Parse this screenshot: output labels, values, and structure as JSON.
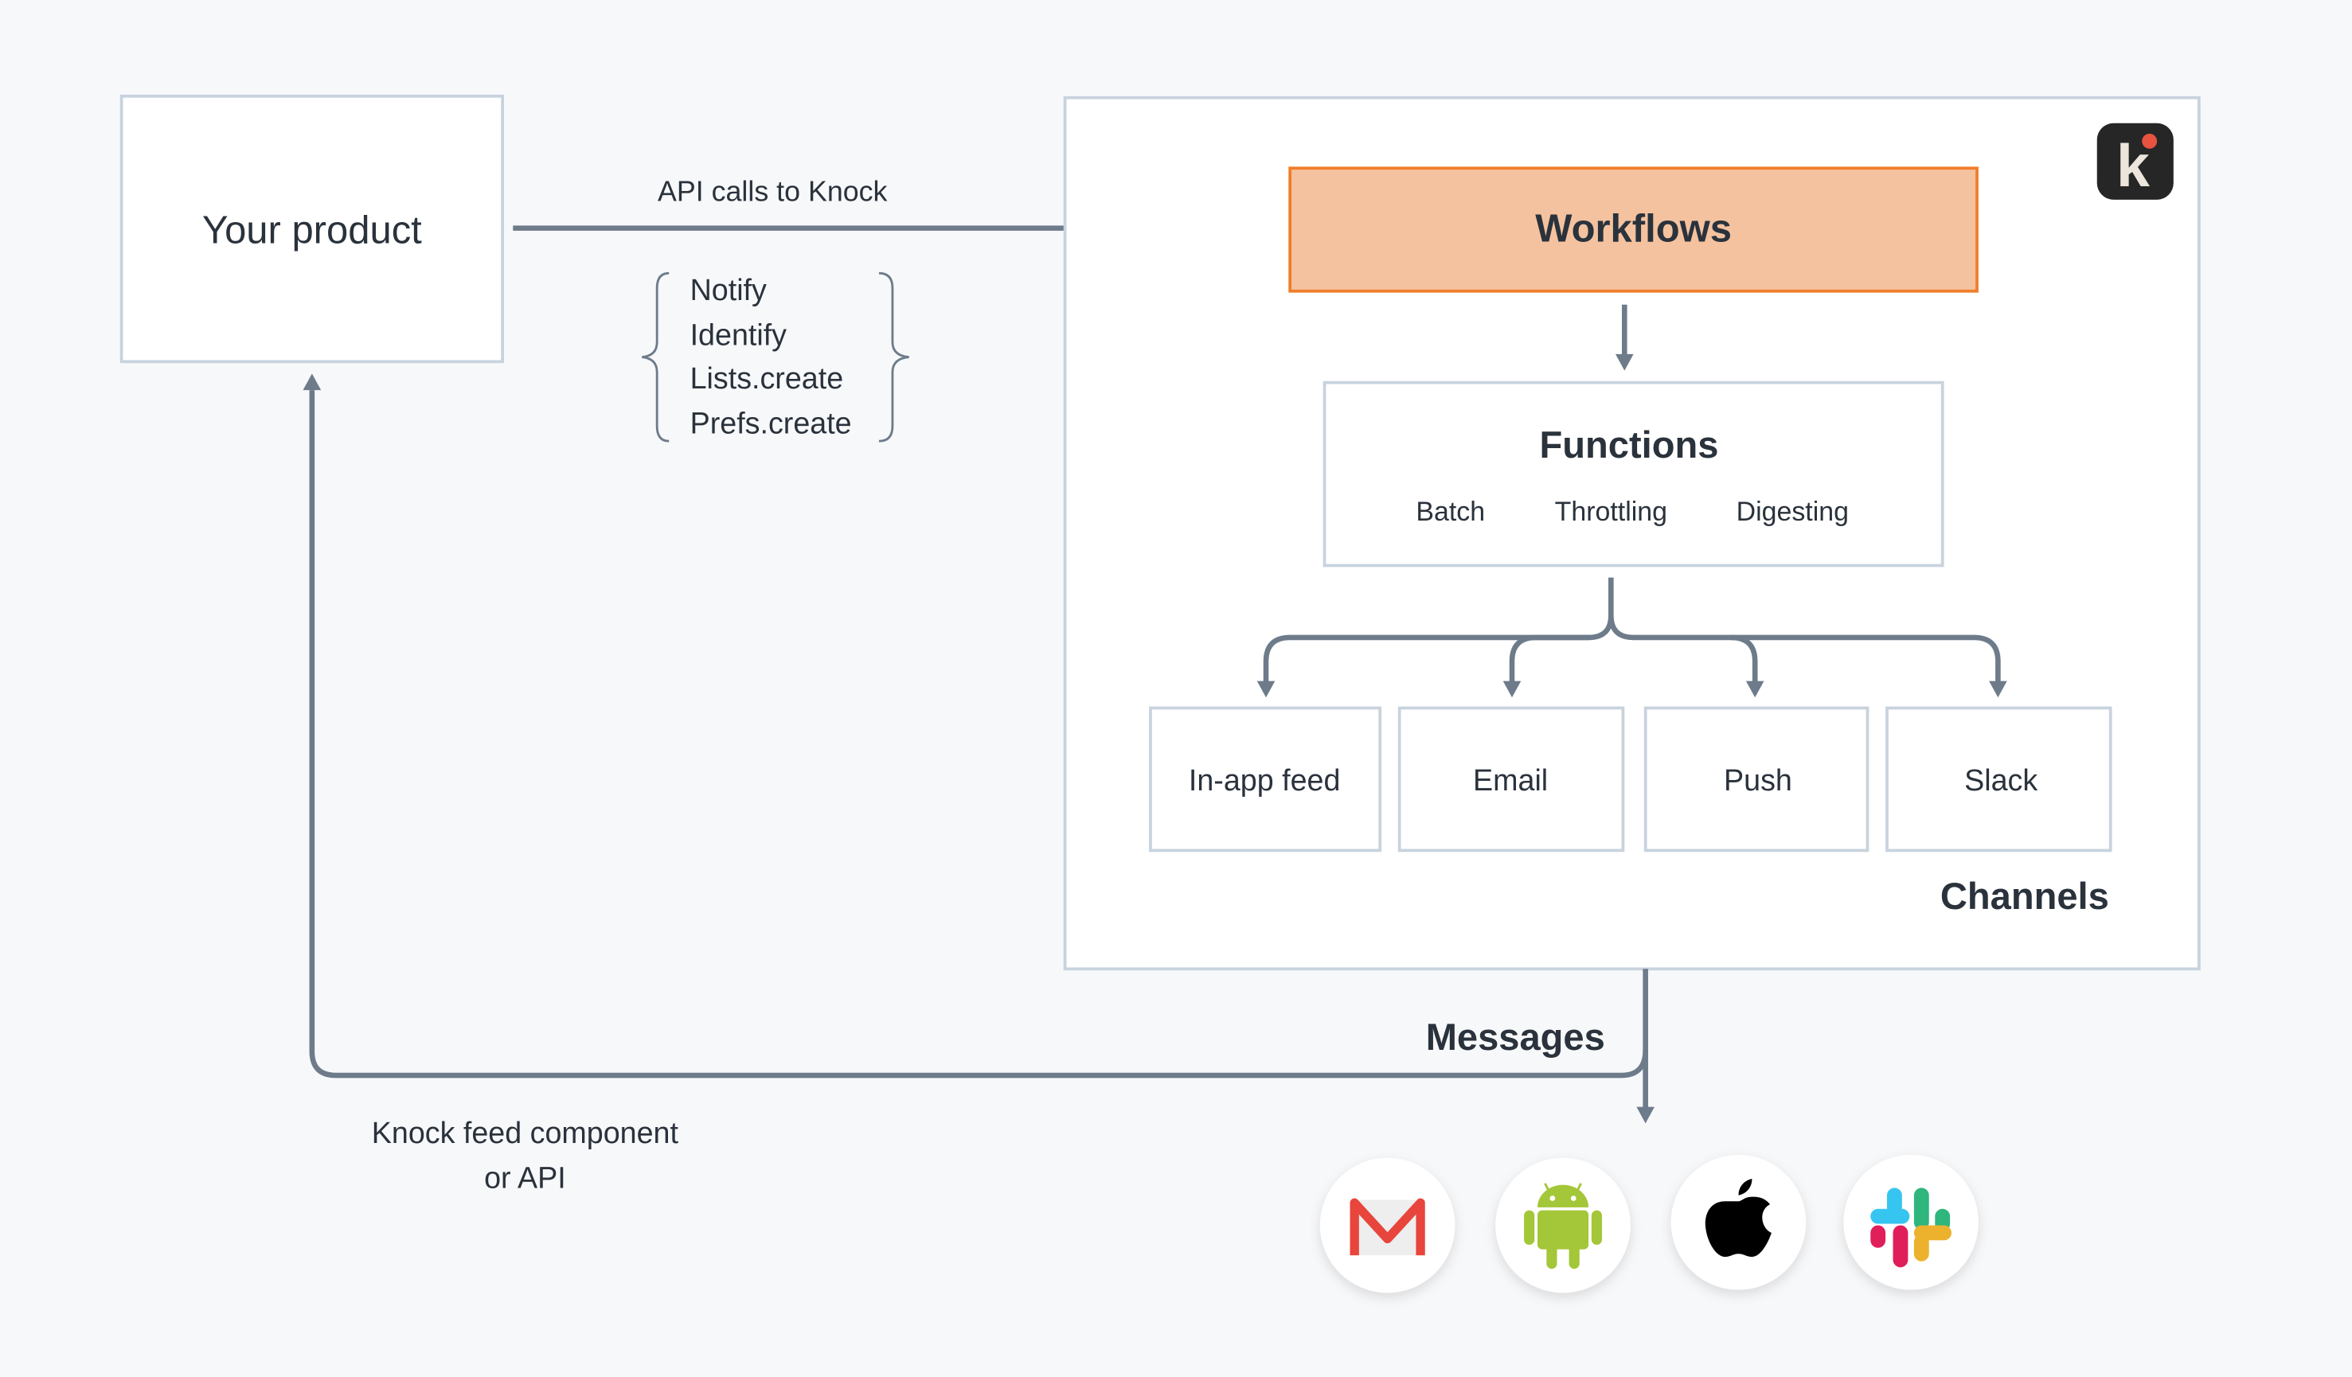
{
  "product": {
    "label": "Your product"
  },
  "api": {
    "label": "API calls to Knock",
    "calls": [
      "Notify",
      "Identify",
      "Lists.create",
      "Prefs.create"
    ]
  },
  "knock": {
    "logo_letter": "k",
    "workflows": "Workflows",
    "functions": {
      "title": "Functions",
      "items": [
        "Batch",
        "Throttling",
        "Digesting"
      ]
    },
    "channels": {
      "title": "Channels",
      "items": [
        "In-app feed",
        "Email",
        "Push",
        "Slack"
      ]
    }
  },
  "messages": "Messages",
  "feed": {
    "line1": "Knock feed component",
    "line2": "or API"
  },
  "providers": [
    "gmail-icon",
    "android-icon",
    "apple-icon",
    "slack-icon"
  ],
  "colors": {
    "workflow_fill": "#f4c29f",
    "workflow_border": "#f07d2b",
    "arrow": "#6d7b8a",
    "logo_bg": "#262626",
    "logo_dot": "#e8533f"
  }
}
